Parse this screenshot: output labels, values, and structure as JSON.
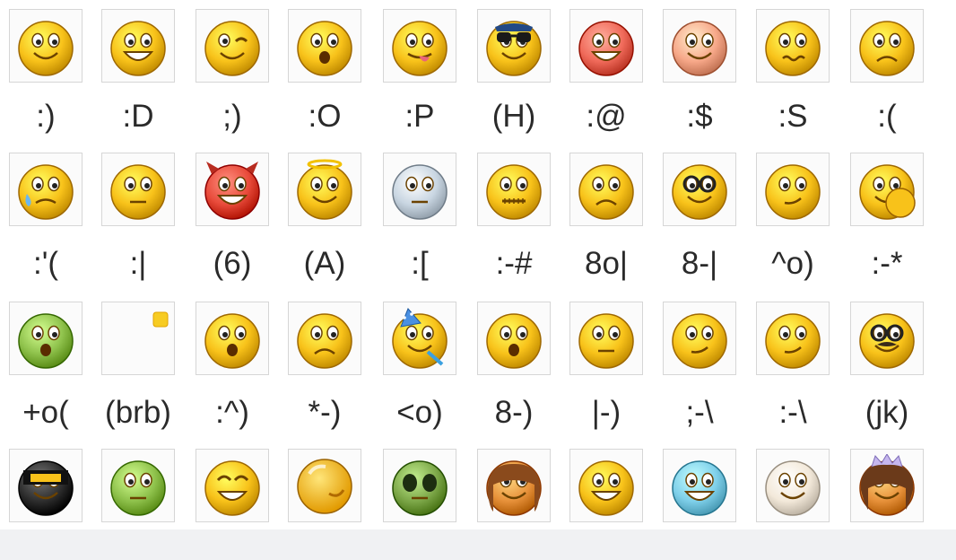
{
  "palette": {
    "face": "#f8c21a",
    "face_dark": "#e39a00",
    "outline": "#9a6200",
    "cell_border": "#d6d6d6",
    "text": "#2a2a2a"
  },
  "rows": [
    {
      "icons": [
        {
          "name": "smile-icon",
          "face": "#f8c21a",
          "variant": "smile"
        },
        {
          "name": "big-grin-icon",
          "face": "#f8c21a",
          "variant": "grin"
        },
        {
          "name": "wink-icon",
          "face": "#f8c21a",
          "variant": "wink"
        },
        {
          "name": "surprised-icon",
          "face": "#f8c21a",
          "variant": "o"
        },
        {
          "name": "tongue-out-icon",
          "face": "#f8c21a",
          "variant": "tongue"
        },
        {
          "name": "hot-sunglasses-icon",
          "face": "#f8c21a",
          "variant": "shades"
        },
        {
          "name": "angry-icon",
          "face": "#f06a5a",
          "variant": "grin"
        },
        {
          "name": "embarrassed-icon",
          "face": "#f7a889",
          "variant": "smile"
        },
        {
          "name": "confused-icon",
          "face": "#f8c21a",
          "variant": "wavy"
        },
        {
          "name": "sad-icon",
          "face": "#f8c21a",
          "variant": "sad"
        }
      ],
      "codes": [
        ":)",
        ":D",
        ";)",
        ":O",
        ":P",
        "(H)",
        ":@",
        ":$",
        ":S",
        ":("
      ]
    },
    {
      "icons": [
        {
          "name": "crying-icon",
          "face": "#f8c21a",
          "variant": "cry"
        },
        {
          "name": "disappointed-icon",
          "face": "#f8c21a",
          "variant": "flat"
        },
        {
          "name": "devil-icon",
          "face": "#e84a3a",
          "variant": "devil"
        },
        {
          "name": "angel-icon",
          "face": "#f8c21a",
          "variant": "angel"
        },
        {
          "name": "baring-teeth-icon",
          "face": "#c9d6e2",
          "variant": "flat"
        },
        {
          "name": "dont-tell-anyone-icon",
          "face": "#f8c21a",
          "variant": "zip"
        },
        {
          "name": "nerd-icon",
          "face": "#f8c21a",
          "variant": "sad"
        },
        {
          "name": "sarcastic-icon",
          "face": "#f8c21a",
          "variant": "glasses"
        },
        {
          "name": "secret-telling-icon",
          "face": "#f8c21a",
          "variant": "smirk"
        },
        {
          "name": "thinking-icon",
          "face": "#f8c21a",
          "variant": "double"
        }
      ],
      "codes": [
        ":'(",
        ":|",
        "(6)",
        "(A)",
        ":[",
        ":-#",
        "8o|",
        "8-|",
        "^o)",
        ":-*"
      ]
    },
    {
      "icons": [
        {
          "name": "sick-icon",
          "face": "#8fc24c",
          "variant": "o"
        },
        {
          "name": "be-right-back-icon",
          "face": "#f8c21a",
          "variant": "brb"
        },
        {
          "name": "i-dont-know-icon",
          "face": "#f8c21a",
          "variant": "o"
        },
        {
          "name": "eye-rolling-icon",
          "face": "#f8c21a",
          "variant": "sad"
        },
        {
          "name": "party-icon",
          "face": "#f8c21a",
          "variant": "party"
        },
        {
          "name": "sleepy-icon",
          "face": "#f8c21a",
          "variant": "o"
        },
        {
          "name": "thinking-face-icon",
          "face": "#f8c21a",
          "variant": "flat"
        },
        {
          "name": "sarcastic-face-icon",
          "face": "#f8c21a",
          "variant": "smirk"
        },
        {
          "name": "skeptical-icon",
          "face": "#f8c21a",
          "variant": "smirk"
        },
        {
          "name": "joking-glasses-icon",
          "face": "#f8c21a",
          "variant": "disguise"
        }
      ],
      "codes": [
        "+o(",
        "(brb)",
        ":^)",
        "*-)",
        "<o)",
        "8-)",
        "|-)",
        ";-\\",
        ":-\\",
        "(jk)"
      ]
    },
    {
      "icons": [
        {
          "name": "ninja-icon",
          "face": "#2e2e2e",
          "variant": "ninja"
        },
        {
          "name": "green-face-icon",
          "face": "#8fc24c",
          "variant": "flat"
        },
        {
          "name": "laughing-icon",
          "face": "#f8c21a",
          "variant": "laugh"
        },
        {
          "name": "hug-icon",
          "face": "#f8c21a",
          "variant": "blank"
        },
        {
          "name": "alien-icon",
          "face": "#7ea94a",
          "variant": "alien"
        },
        {
          "name": "woman-icon",
          "face": "#e7913a",
          "variant": "woman"
        },
        {
          "name": "grin-icon",
          "face": "#f8c21a",
          "variant": "grin"
        },
        {
          "name": "cold-icon",
          "face": "#7fd0ea",
          "variant": "grin"
        },
        {
          "name": "pale-icon",
          "face": "#f3e9da",
          "variant": "smile"
        },
        {
          "name": "princess-icon",
          "face": "#e7913a",
          "variant": "princess"
        }
      ],
      "codes": []
    }
  ]
}
